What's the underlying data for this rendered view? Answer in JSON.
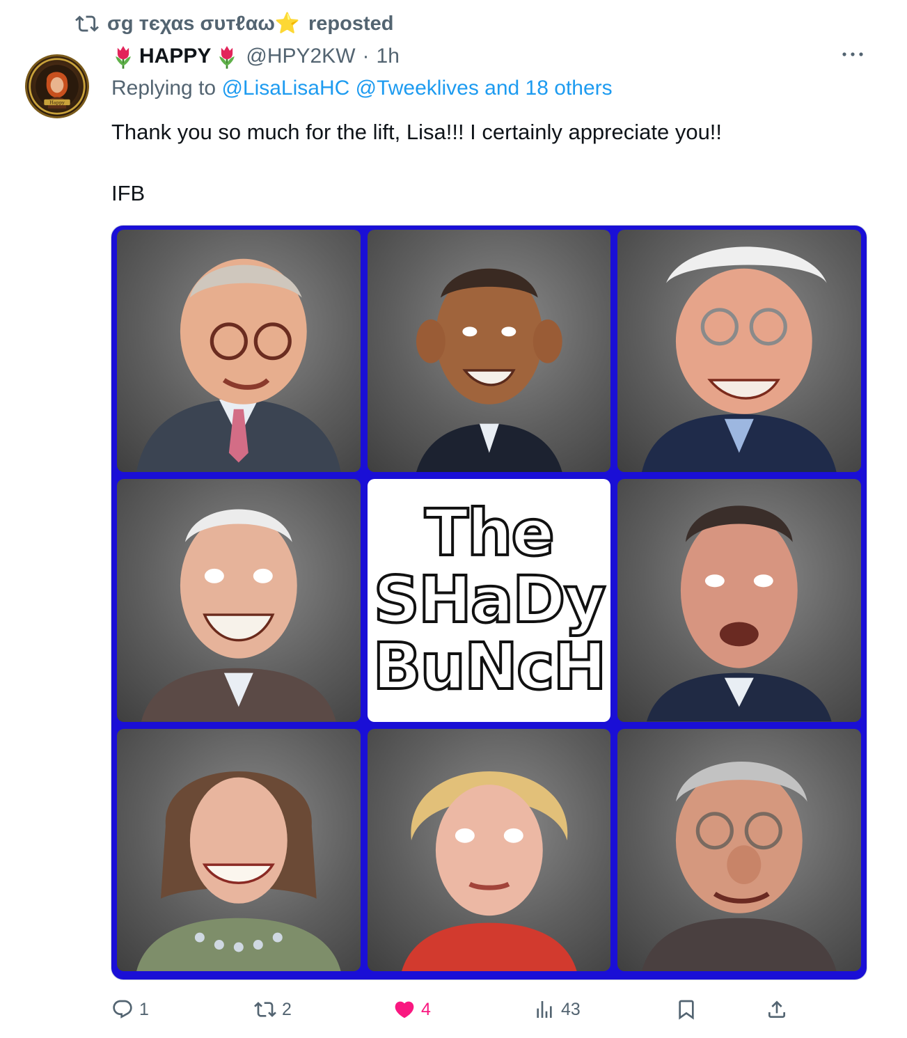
{
  "repost_bar": {
    "reposter": "σg тєχαѕ συтℓαω⭐",
    "suffix": "reposted"
  },
  "author": {
    "display_name": "HAPPY",
    "handle": "@HPY2KW",
    "separator": "·",
    "time": "1h",
    "avatar_text": "Happy"
  },
  "reply": {
    "prefix": "Replying to",
    "mention_1": "@LisaLisaHC",
    "mention_2": "@Tweeklives",
    "others": "and 18 others"
  },
  "tweet": {
    "text": "Thank you so much for the lift, Lisa!!! I certainly appreciate you!!\n\nIFB"
  },
  "media": {
    "title_lines": [
      "The",
      "SHaDy",
      "BuNcH"
    ],
    "frame_color": "#1a0fd6"
  },
  "actions": {
    "replies": "1",
    "reposts": "2",
    "likes": "4",
    "views": "43"
  },
  "colors": {
    "accent": "#1d9bf0",
    "like": "#f91880",
    "muted": "#536471"
  }
}
